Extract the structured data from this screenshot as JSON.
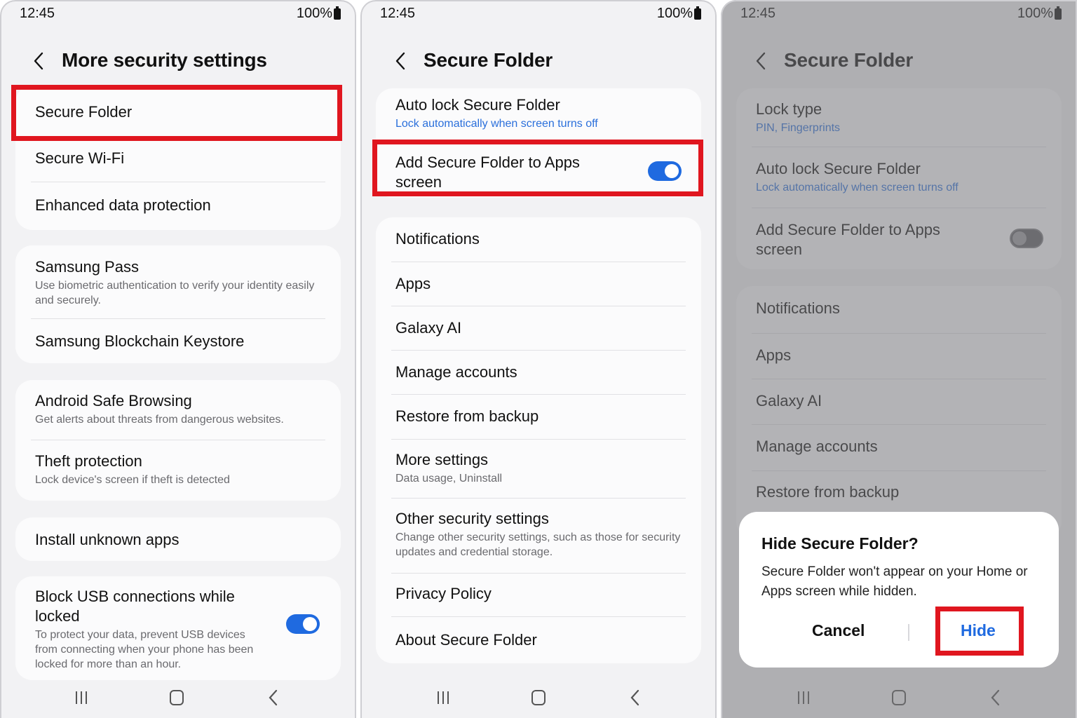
{
  "status": {
    "time": "12:45",
    "battery": "100%"
  },
  "colors": {
    "highlight": "#e0161f",
    "accent": "#1f6ae0",
    "link_text": "#2a6fdb"
  },
  "screen1": {
    "title": "More security settings",
    "items": [
      {
        "label": "Secure Folder"
      },
      {
        "label": "Secure Wi-Fi"
      },
      {
        "label": "Enhanced data protection"
      },
      {
        "label": "Samsung Pass",
        "sub": "Use biometric authentication to verify your identity easily and securely."
      },
      {
        "label": "Samsung Blockchain Keystore"
      },
      {
        "label": "Android Safe Browsing",
        "sub": "Get alerts about threats from dangerous websites."
      },
      {
        "label": "Theft protection",
        "sub": "Lock device's screen if theft is detected"
      },
      {
        "label": "Install unknown apps"
      },
      {
        "label": "Block USB connections while locked",
        "sub": "To protect your data, prevent USB devices from connecting when your phone has been locked for more than an hour.",
        "toggle": "on"
      }
    ]
  },
  "screen2": {
    "title": "Secure Folder",
    "items": [
      {
        "label": "Auto lock Secure Folder",
        "sub": "Lock automatically when screen turns off"
      },
      {
        "label": "Add Secure Folder to Apps screen",
        "toggle": "on"
      },
      {
        "label": "Notifications"
      },
      {
        "label": "Apps"
      },
      {
        "label": "Galaxy AI"
      },
      {
        "label": "Manage accounts"
      },
      {
        "label": "Restore from backup"
      },
      {
        "label": "More settings",
        "sub": "Data usage, Uninstall"
      },
      {
        "label": "Other security settings",
        "sub": "Change other security settings, such as those for security updates and credential storage."
      },
      {
        "label": "Privacy Policy"
      },
      {
        "label": "About Secure Folder"
      }
    ]
  },
  "screen3": {
    "title": "Secure Folder",
    "items": [
      {
        "label": "Lock type",
        "sub": "PIN, Fingerprints"
      },
      {
        "label": "Auto lock Secure Folder",
        "sub": "Lock automatically when screen turns off"
      },
      {
        "label": "Add Secure Folder to Apps screen",
        "toggle": "off"
      },
      {
        "label": "Notifications"
      },
      {
        "label": "Apps"
      },
      {
        "label": "Galaxy AI"
      },
      {
        "label": "Manage accounts"
      },
      {
        "label": "Restore from backup"
      }
    ],
    "dialog": {
      "title": "Hide Secure Folder?",
      "body": "Secure Folder won't appear on your Home or Apps screen while hidden.",
      "cancel": "Cancel",
      "confirm": "Hide"
    }
  }
}
